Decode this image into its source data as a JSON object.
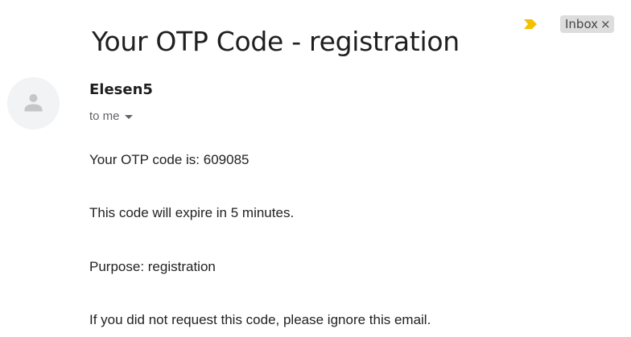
{
  "email": {
    "subject": "Your OTP Code - registration",
    "important_icon": "importance-marker-icon",
    "label": {
      "text": "Inbox",
      "close_glyph": "×"
    },
    "sender": {
      "name": "Elesen5",
      "avatar_icon": "default-person-avatar-icon",
      "recipient_label": "to me",
      "recipient_dropdown_icon": "caret-down-icon"
    },
    "body": [
      "Your OTP code is: 609085",
      "This code will expire in 5 minutes.",
      "Purpose: registration",
      "If you did not request this code, please ignore this email."
    ]
  },
  "colors": {
    "important_marker": "#f2c200",
    "label_chip_bg": "#dddddd",
    "avatar_bg": "#f1f3f4",
    "avatar_figure": "#c4c7c5"
  }
}
